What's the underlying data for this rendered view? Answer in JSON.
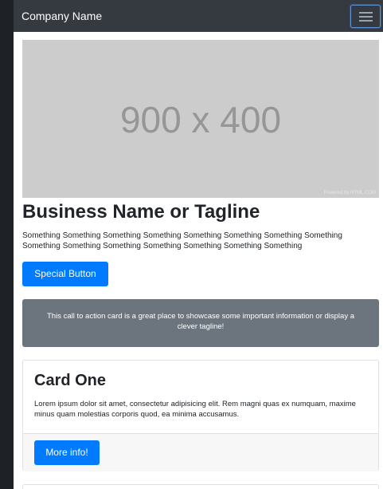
{
  "navbar": {
    "brand": "Company Name",
    "toggler_icon": "hamburger-icon"
  },
  "hero": {
    "placeholder_text": "900 x 400",
    "credit": "Powered by HTML.COM"
  },
  "intro": {
    "title": "Business Name or Tagline",
    "description": "Something Something Something Something Something Something Something Something Something Something Something Something Something Something Something",
    "button_label": "Special Button"
  },
  "call_to_action": {
    "text": "This call to action card is a great place to showcase some important information or display a clever tagline!"
  },
  "card_one": {
    "title": "Card One",
    "text": "Lorem ipsum dolor sit amet, consectetur adipisicing elit. Rem magni quas ex numquam, maxime minus quam molestias corporis quod, ea minima accusamus.",
    "button_label": "More info!"
  },
  "colors": {
    "navbar_bg": "#343a40",
    "primary": "#007bff",
    "cta_bg": "#6c757d",
    "hero_bg": "#cccccc"
  }
}
